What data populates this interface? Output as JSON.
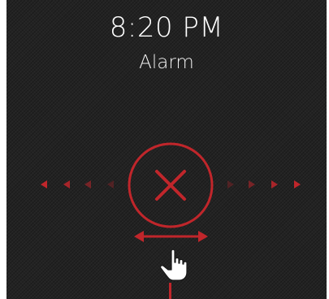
{
  "status": {
    "time": "8:20 PM",
    "title": "Alarm"
  },
  "controls": {
    "dismiss_icon": "close-icon",
    "swipe_hint_icon": "double-arrow-icon",
    "gesture_icon": "pointing-hand-icon"
  },
  "colors": {
    "accent": "#c0262b",
    "background": "#232323",
    "text": "#ffffff"
  }
}
